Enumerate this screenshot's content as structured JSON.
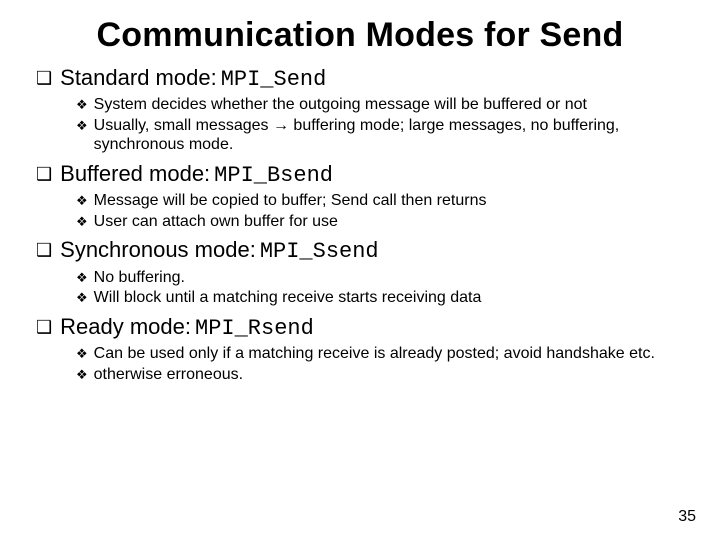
{
  "title": "Communication Modes for Send",
  "sections": [
    {
      "label": "Standard mode: ",
      "code": "MPI_Send",
      "items": [
        "System decides whether the outgoing message will be buffered or not",
        "Usually, small messages → buffering mode; large messages, no buffering, synchronous mode."
      ]
    },
    {
      "label": "Buffered mode: ",
      "code": "MPI_Bsend",
      "items": [
        "Message will be copied to buffer; Send call then returns",
        "User can attach own buffer for use"
      ]
    },
    {
      "label": "Synchronous mode: ",
      "code": "MPI_Ssend",
      "items": [
        "No buffering.",
        "Will block until a matching receive starts receiving data"
      ]
    },
    {
      "label": "Ready mode: ",
      "code": "MPI_Rsend",
      "items": [
        "Can be used only if a matching receive is already posted; avoid handshake etc.",
        "otherwise erroneous."
      ]
    }
  ],
  "page_number": "35",
  "bullets": {
    "square": "❑",
    "diamond": "❖",
    "arrow": "→"
  }
}
